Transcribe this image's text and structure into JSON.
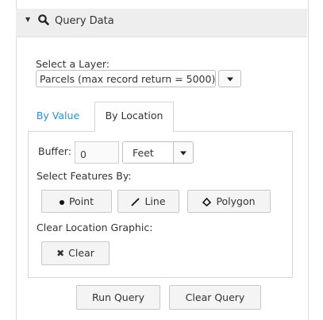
{
  "header": {
    "title": "Query Data",
    "icon": "search-icon",
    "caret_icon": "caret-down-icon"
  },
  "layer": {
    "label": "Select a Layer:",
    "selected": "Parcels (max record return = 5000)"
  },
  "tabs": {
    "by_value": "By Value",
    "by_location": "By Location",
    "active": "By Location"
  },
  "location": {
    "buffer_label": "Buffer:",
    "buffer_value": "0",
    "unit_selected": "Feet",
    "select_features_label": "Select Features By:",
    "buttons": {
      "point": "Point",
      "line": "Line",
      "polygon": "Polygon"
    },
    "clear_graphic_label": "Clear Location Graphic:",
    "clear_button": "Clear"
  },
  "footer": {
    "run_query": "Run Query",
    "clear_query": "Clear Query"
  },
  "colors": {
    "tab_link": "#2a8fc9",
    "header_bg": "#eeeeee",
    "border": "#d6d6d6"
  }
}
